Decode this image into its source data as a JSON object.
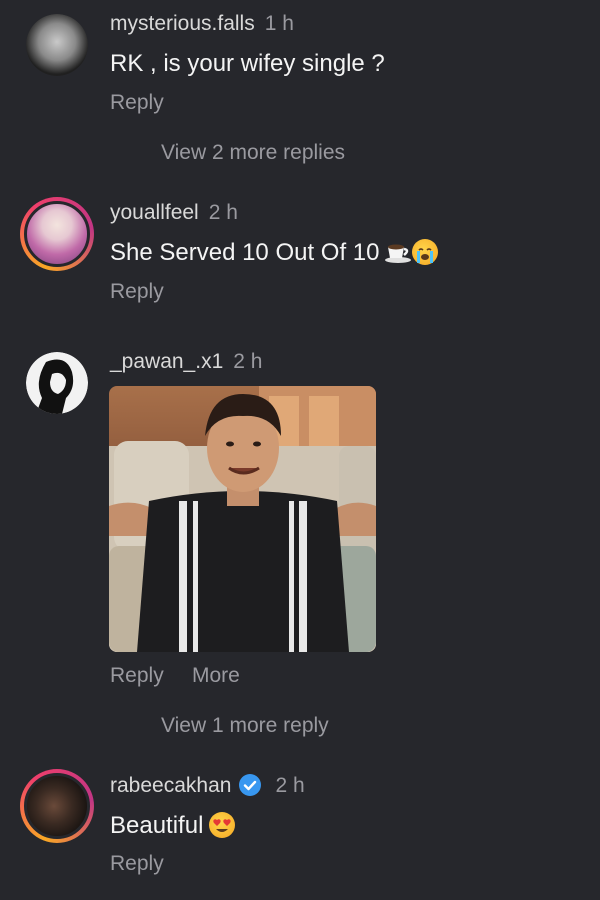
{
  "comments": [
    {
      "username": "mysterious.falls",
      "time": "1 h",
      "text": "RK , is your wifey single ?",
      "reply_label": "Reply",
      "view_more": "View 2 more replies"
    },
    {
      "username": "youallfeel",
      "time": "2 h",
      "text": "She Served 10 Out Of 10",
      "emojis": [
        "coffee-cup-emoji",
        "crying-face-emoji"
      ],
      "reply_label": "Reply"
    },
    {
      "username": "_pawan_.x1",
      "time": "2 h",
      "media": "gif-image",
      "reply_label": "Reply",
      "more_label": "More",
      "view_more": "View 1 more reply"
    },
    {
      "username": "rabeecakhan",
      "verified": true,
      "time": "2 h",
      "text": "Beautiful",
      "emojis": [
        "heart-eyes-emoji"
      ],
      "reply_label": "Reply"
    }
  ],
  "colors": {
    "background": "#26272c",
    "secondary_text": "#9a9aa0",
    "verified_badge": "#3897f0"
  }
}
